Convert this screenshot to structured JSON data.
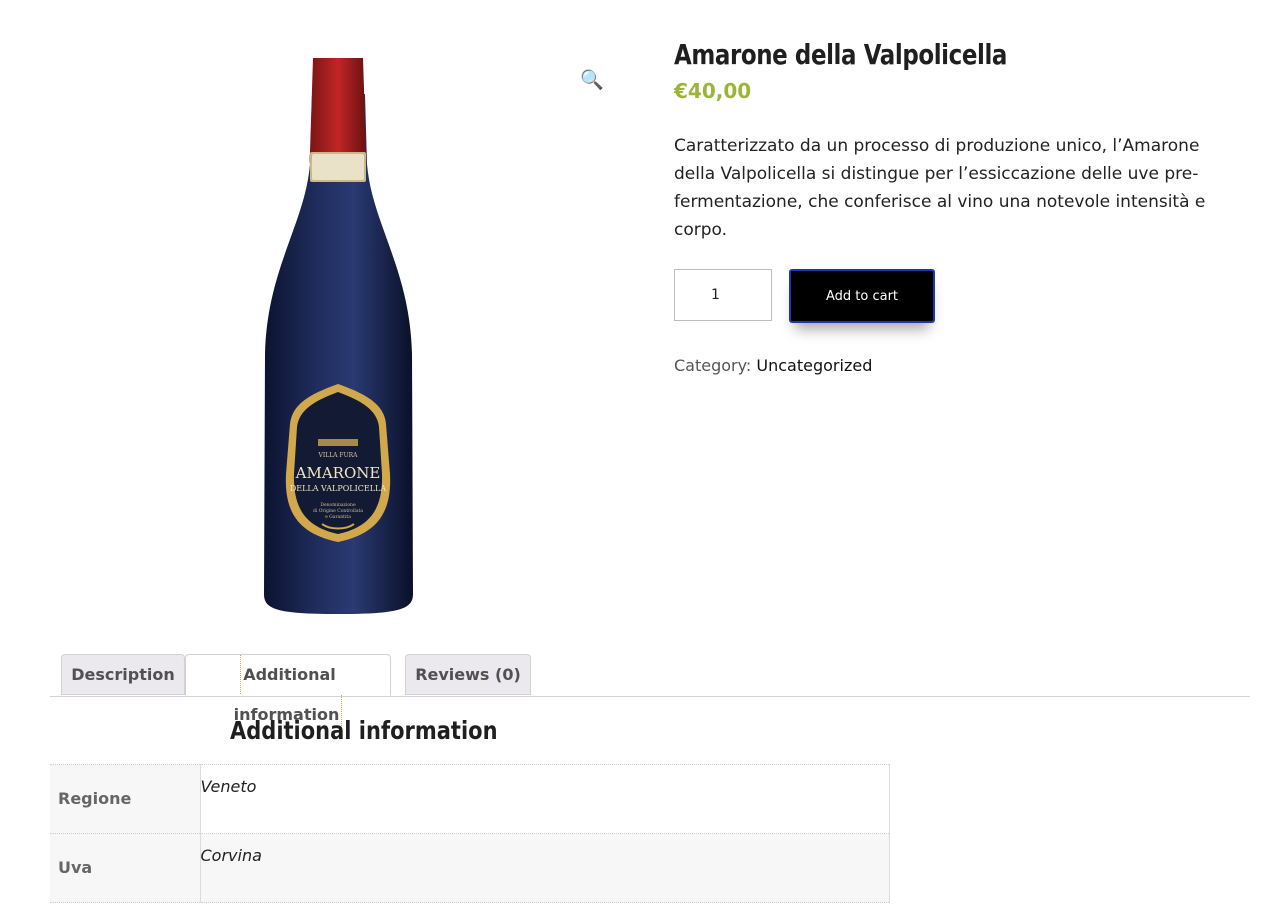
{
  "product": {
    "title": "Amarone della Valpolicella",
    "price": "€40,00",
    "description": "Caratterizzato da un processo di produzione unico, l’Amarone della Valpolicella si distingue per l’essiccazione delle uve pre-fermentazione, che conferisce al vino una notevole intensità e corpo.",
    "quantity": "1",
    "add_to_cart_label": "Add to cart",
    "category_label": "Category:",
    "category_value": "Uncategorized",
    "image": {
      "label_brand": "VILLA FURA",
      "label_title": "AMARONE",
      "label_subtitle": "DELLA VALPOLICELLA",
      "label_small": [
        "Denominazione",
        "di Origine Controllata",
        "e Garantita"
      ]
    }
  },
  "icons": {
    "zoom": "magnifier-icon"
  },
  "tabs": [
    {
      "label": "Description"
    },
    {
      "label": "Additional information"
    },
    {
      "label": "Reviews (0)"
    }
  ],
  "panel": {
    "title": "Additional information",
    "rows": [
      {
        "name": "Regione",
        "value": "Veneto"
      },
      {
        "name": "Uva",
        "value": "Corvina"
      }
    ]
  },
  "colors": {
    "price": "#9bb439",
    "button_bg": "#000000",
    "button_border": "#1b3aa8"
  }
}
